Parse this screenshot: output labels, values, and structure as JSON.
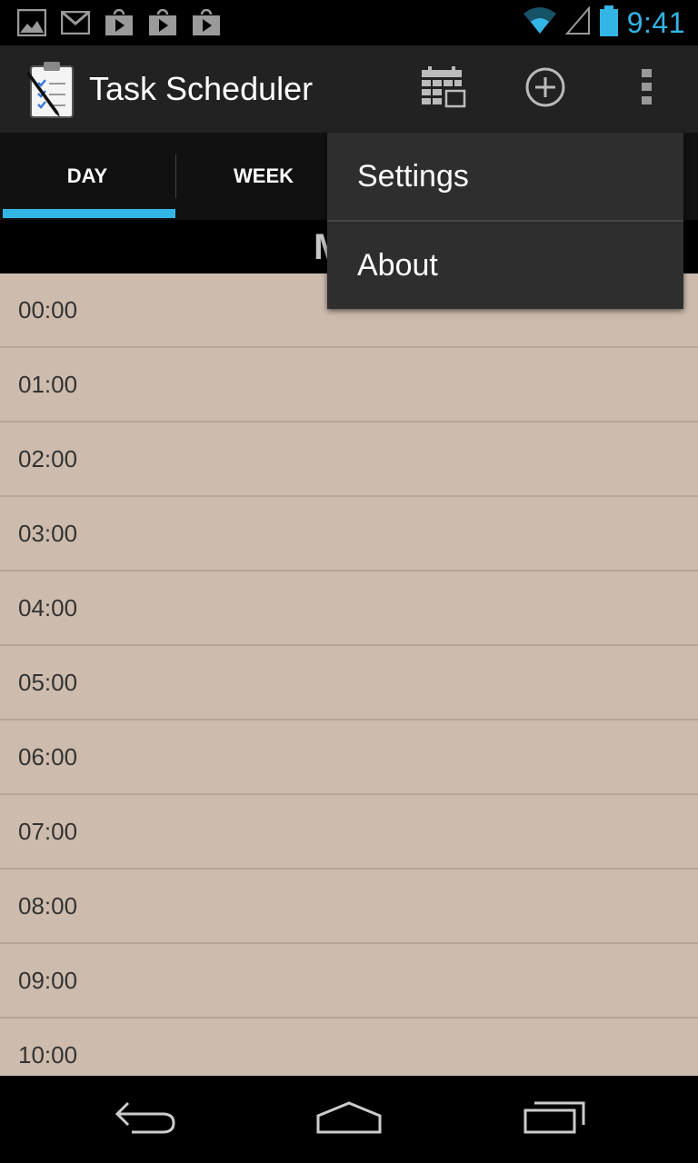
{
  "status_bar": {
    "time": "9:41",
    "notification_icons": [
      "gallery-icon",
      "gmail-icon",
      "play-store-icon",
      "play-store-icon",
      "play-store-icon"
    ],
    "accent_color": "#33b5e5"
  },
  "action_bar": {
    "title": "Task Scheduler",
    "actions": [
      "calendar-icon",
      "add-icon",
      "overflow-menu-icon"
    ]
  },
  "tabs": [
    {
      "label": "DAY",
      "selected": true
    },
    {
      "label": "WEEK",
      "selected": false
    }
  ],
  "date_header": "May",
  "hours": [
    "00:00",
    "01:00",
    "02:00",
    "03:00",
    "04:00",
    "05:00",
    "06:00",
    "07:00",
    "08:00",
    "09:00",
    "10:00"
  ],
  "overflow_menu": {
    "items": [
      "Settings",
      "About"
    ]
  },
  "nav_bar": {
    "buttons": [
      "back-icon",
      "home-icon",
      "recent-apps-icon"
    ]
  },
  "colors": {
    "list_background": "#cdbcad",
    "tab_indicator": "#33b5e5",
    "menu_background": "#2e2e2e"
  }
}
